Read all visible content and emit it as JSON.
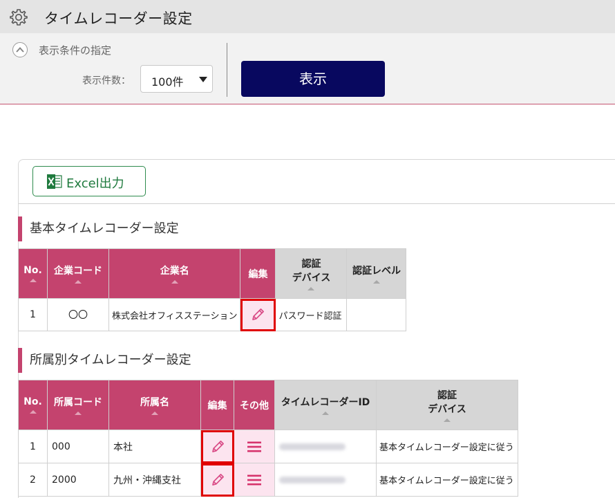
{
  "header": {
    "title": "タイムレコーダー設定",
    "icon": "gear-icon"
  },
  "filter": {
    "section_label": "表示条件の指定",
    "count_label": "表示件数：",
    "count_value": "100件",
    "show_button": "表示"
  },
  "toolbar": {
    "excel_button": "Excel出力"
  },
  "basic": {
    "title": "基本タイムレコーダー設定",
    "headers": {
      "no": "No.",
      "company_code": "企業コード",
      "company_name": "企業名",
      "edit": "編集",
      "auth_device": [
        "認証",
        "デバイス"
      ],
      "auth_level": "認証レベル"
    },
    "rows": [
      {
        "no": "1",
        "company_code": "〇〇",
        "company_name": "株式会社オフィスステーション",
        "auth_device": "パスワード認証",
        "auth_level": ""
      }
    ]
  },
  "dept": {
    "title": "所属別タイムレコーダー設定",
    "headers": {
      "no": "No.",
      "dept_code": "所属コード",
      "dept_name": "所属名",
      "edit": "編集",
      "other": "その他",
      "recorder_id": "タイムレコーダーID",
      "auth_device": [
        "認証",
        "デバイス"
      ]
    },
    "rows": [
      {
        "no": "1",
        "dept_code": "000",
        "dept_name": "本社",
        "auth_device": "基本タイムレコーダー設定に従う"
      },
      {
        "no": "2",
        "dept_code": "2000",
        "dept_name": "九州・沖縄支社",
        "auth_device": "基本タイムレコーダー設定に従う"
      }
    ]
  },
  "colors": {
    "accent": "#c4436e",
    "primary_button": "#08085f",
    "excel_green": "#1f7a3e",
    "edit_cell_bg": "#fce4ef",
    "highlight": "#e00000"
  }
}
